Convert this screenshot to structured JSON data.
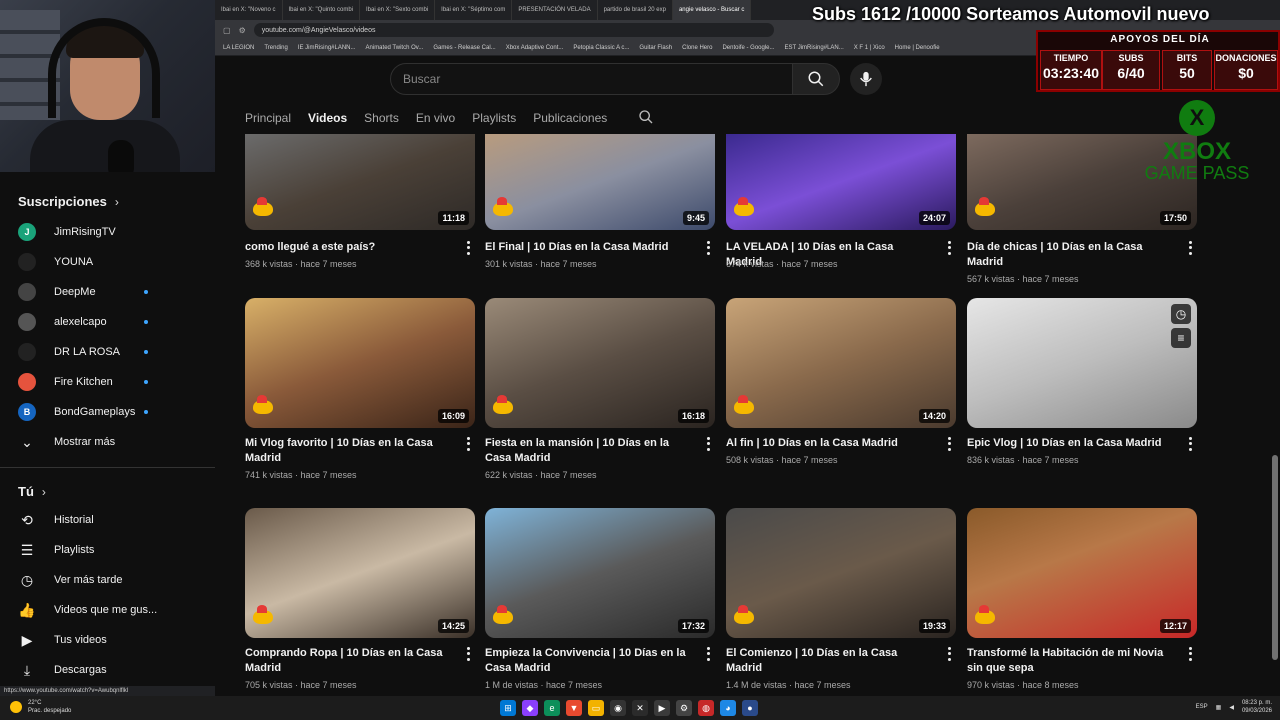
{
  "browser": {
    "tabs": [
      "Ibai en X: \"Noveno c",
      "Ibai en X: \"Quinto combi",
      "Ibai en X: \"Sexto combi",
      "Ibai en X: \"Séptimo com",
      "PRESENTACIÓN VELADA",
      "partido de brasil 20 exp",
      "angie velasco - Buscar c"
    ],
    "url": "youtube.com/@AngieVelasco/videos",
    "bookmarks": [
      "LA LEGION",
      "Trending",
      "IE JimRising#LANN...",
      "Animated Twitch Ov...",
      "Games - Release Cal...",
      "Xbox Adaptive Cont...",
      "Petopia Classic A c...",
      "Guitar Flash",
      "Clone Hero",
      "Dentoife - Google...",
      "EST JimRising#LAN...",
      "X F 1 | Xico",
      "Home | Denoofie"
    ]
  },
  "sidebar": {
    "subs_title": "Suscripciones",
    "subscriptions": [
      {
        "name": "JimRisingTV",
        "initial": "J",
        "color": "#1aa37a",
        "dot": false
      },
      {
        "name": "YOUNA",
        "initial": "",
        "color": "#222222",
        "dot": false
      },
      {
        "name": "DeepMe",
        "initial": "",
        "color": "#444444",
        "dot": true
      },
      {
        "name": "alexelcapo",
        "initial": "",
        "color": "#555555",
        "dot": true
      },
      {
        "name": "DR LA ROSA",
        "initial": "",
        "color": "#222222",
        "dot": true
      },
      {
        "name": "Fire Kitchen",
        "initial": "",
        "color": "#e5533d",
        "dot": true
      },
      {
        "name": "BondGameplays",
        "initial": "B",
        "color": "#1565c0",
        "dot": true
      }
    ],
    "show_more": "Mostrar más",
    "you_title": "Tú",
    "you_items": [
      {
        "label": "Historial",
        "icon": "history-icon",
        "glyph": "⟲"
      },
      {
        "label": "Playlists",
        "icon": "playlists-icon",
        "glyph": "☰"
      },
      {
        "label": "Ver más tarde",
        "icon": "watch-later-icon",
        "glyph": "◷"
      },
      {
        "label": "Videos que me gus...",
        "icon": "liked-videos-icon",
        "glyph": "👍"
      },
      {
        "label": "Tus videos",
        "icon": "your-videos-icon",
        "glyph": "▶"
      },
      {
        "label": "Descargas",
        "icon": "downloads-icon",
        "glyph": "⤓"
      }
    ],
    "status_url": "https://www.youtube.com/watch?v=Awubqnlflkl"
  },
  "search": {
    "placeholder": "Buscar"
  },
  "channel_tabs": [
    "Principal",
    "Videos",
    "Shorts",
    "En vivo",
    "Playlists",
    "Publicaciones"
  ],
  "active_tab": "Videos",
  "videos": [
    {
      "title": "como llegué a este país?",
      "views": "368 k vistas",
      "ago": "hace 7 meses",
      "duration": "11:18",
      "bg": "linear-gradient(160deg,#6b6b6b 0%,#4a4037 50%,#2e2a27 100%)"
    },
    {
      "title": "El Final | 10 Días en la Casa Madrid",
      "views": "301 k vistas",
      "ago": "hace 7 meses",
      "duration": "9:45",
      "bg": "linear-gradient(160deg,#b89b7e 0%,#8a8fa0 50%,#3d4a6b 100%)"
    },
    {
      "title": "LA VELADA | 10 Días en la Casa Madrid",
      "views": "674 k vistas",
      "ago": "hace 7 meses",
      "duration": "24:07",
      "bg": "linear-gradient(160deg,#3b2a8f 0%,#7b4fd6 50%,#2a1a5e 100%)"
    },
    {
      "title": "Día de chicas | 10 Días en la Casa Madrid",
      "views": "567 k vistas",
      "ago": "hace 7 meses",
      "duration": "17:50",
      "bg": "linear-gradient(160deg,#7d6a5e 0%,#4b403a 50%,#2d2622 100%)"
    },
    {
      "title": "Mi Vlog favorito | 10 Días en la Casa Madrid",
      "views": "741 k vistas",
      "ago": "hace 7 meses",
      "duration": "16:09",
      "bg": "linear-gradient(160deg,#d8b068 0%,#8a5a3a 50%,#3a2418 100%)"
    },
    {
      "title": "Fiesta en la mansión | 10 Días en la Casa Madrid",
      "views": "622 k vistas",
      "ago": "hace 7 meses",
      "duration": "16:18",
      "bg": "linear-gradient(160deg,#9a8a78 0%,#5a4e44 50%,#2a2420 100%)"
    },
    {
      "title": "Al fin | 10 Días en la Casa Madrid",
      "views": "508 k vistas",
      "ago": "hace 7 meses",
      "duration": "14:20",
      "bg": "linear-gradient(160deg,#c8a478 0%,#8a6a4c 50%,#4a3a2e 100%)"
    },
    {
      "title": "Epic Vlog | 10 Días en la Casa Madrid",
      "views": "836 k vistas",
      "ago": "hace 7 meses",
      "duration": "",
      "bg": "linear-gradient(160deg,#e6e6e6 0%,#bdbdbd 50%,#8a8a8a 100%)"
    },
    {
      "title": "Comprando Ropa | 10 Días en la Casa Madrid",
      "views": "705 k vistas",
      "ago": "hace 7 meses",
      "duration": "14:25",
      "bg": "linear-gradient(160deg,#6a5a4a 0%,#c9b9a4 50%,#3a3028 100%)"
    },
    {
      "title": "Empieza la Convivencia | 10 Días en la Casa Madrid",
      "views": "1 M de vistas",
      "ago": "hace 7 meses",
      "duration": "17:32",
      "bg": "linear-gradient(160deg,#7fb3d8 0%,#5a5a5a 50%,#2a2a2a 100%)"
    },
    {
      "title": "El Comienzo | 10 Días en la Casa Madrid",
      "views": "1.4 M de vistas",
      "ago": "hace 7 meses",
      "duration": "19:33",
      "bg": "linear-gradient(160deg,#4a4a4a 0%,#6a5a4a 50%,#2a2420 100%)"
    },
    {
      "title": "Transformé la Habitación de mi Novia sin que sepa",
      "views": "970 k vistas",
      "ago": "hace 8 meses",
      "duration": "12:17",
      "bg": "linear-gradient(160deg,#8a5a2a 0%,#b87848 40%,#c82828 100%)"
    }
  ],
  "overlay": {
    "subs_banner": "Subs 1612 /10000 Sorteamos Automovil nuevo",
    "stats_title": "APOYOS DEL DÍA",
    "stats": [
      {
        "label": "TIEMPO",
        "value": "03:23:40"
      },
      {
        "label": "SUBS",
        "value": "6/40"
      },
      {
        "label": "BITS",
        "value": "50"
      },
      {
        "label": "DONACIONES",
        "value": "$0"
      }
    ],
    "xbox_line1": "XBOX",
    "xbox_line2": "GAME PASS"
  },
  "taskbar": {
    "temp": "22°C",
    "weather": "Prac. despejado",
    "lang": "ESP",
    "time": "08:23 p. m.",
    "date": "09/03/2026"
  }
}
